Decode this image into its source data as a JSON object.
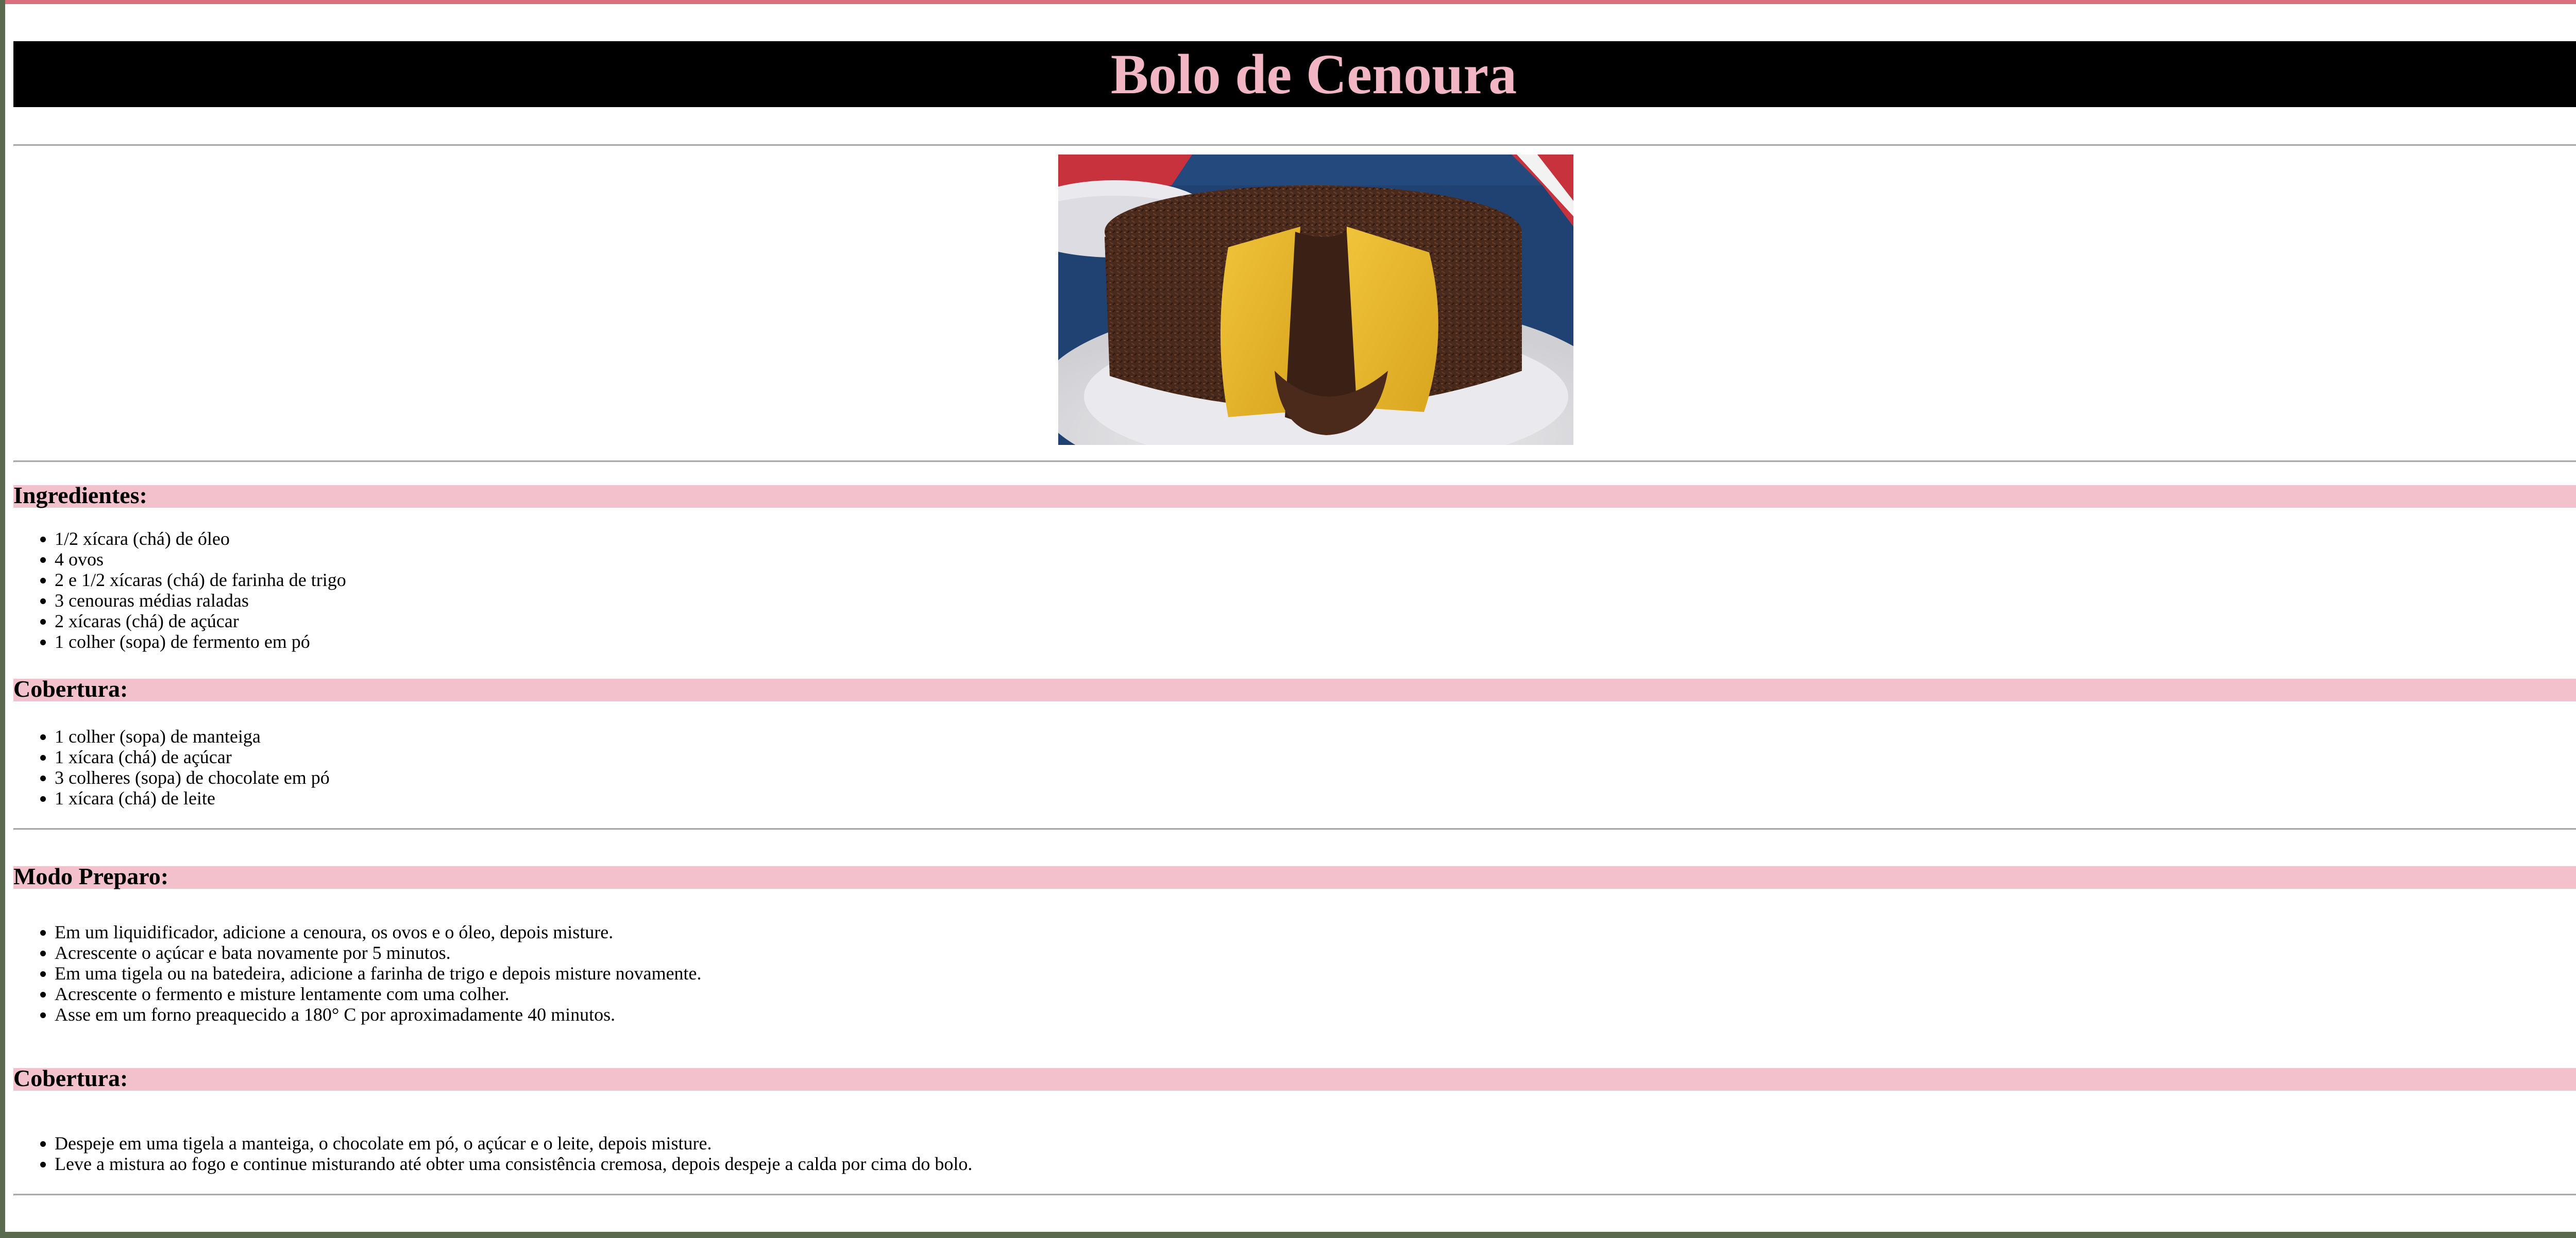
{
  "page": {
    "title": "Bolo de Cenoura"
  },
  "hero_image": {
    "alt": "Bolo de cenoura com cobertura de chocolate e granulado"
  },
  "ingredientes": {
    "heading": "Ingredientes:",
    "items": [
      "1/2 xícara (chá) de óleo",
      "4 ovos",
      "2 e 1/2 xícaras (chá) de farinha de trigo",
      "3 cenouras médias raladas",
      "2 xícaras (chá) de açúcar",
      "1 colher (sopa) de fermento em pó"
    ]
  },
  "cobertura_ingredientes": {
    "heading": "Cobertura:",
    "items": [
      "1 colher (sopa) de manteiga",
      "1 xícara (chá) de açúcar",
      "3 colheres (sopa) de chocolate em pó",
      "1 xícara (chá) de leite"
    ]
  },
  "modo_preparo": {
    "heading": "Modo Preparo:",
    "items": [
      "Em um liquidificador, adicione a cenoura, os ovos e o óleo, depois misture.",
      "Acrescente o açúcar e bata novamente por 5 minutos.",
      "Em uma tigela ou na batedeira, adicione a farinha de trigo e depois misture novamente.",
      "Acrescente o fermento e misture lentamente com uma colher.",
      "Asse em um forno preaquecido a 180° C por aproximadamente 40 minutos."
    ]
  },
  "cobertura_preparo": {
    "heading": "Cobertura:",
    "items": [
      "Despeje em uma tigela a manteiga, o chocolate em pó, o açúcar e o leite, depois misture.",
      "Leve a mistura ao fogo e continue misturando até obter uma consistência cremosa, depois despeje a calda por cima do bolo."
    ]
  },
  "colors": {
    "title_text": "#f2b5c4",
    "title_background": "#000000",
    "section_background": "#f2c1cb",
    "window_top_border": "#d9707e"
  }
}
